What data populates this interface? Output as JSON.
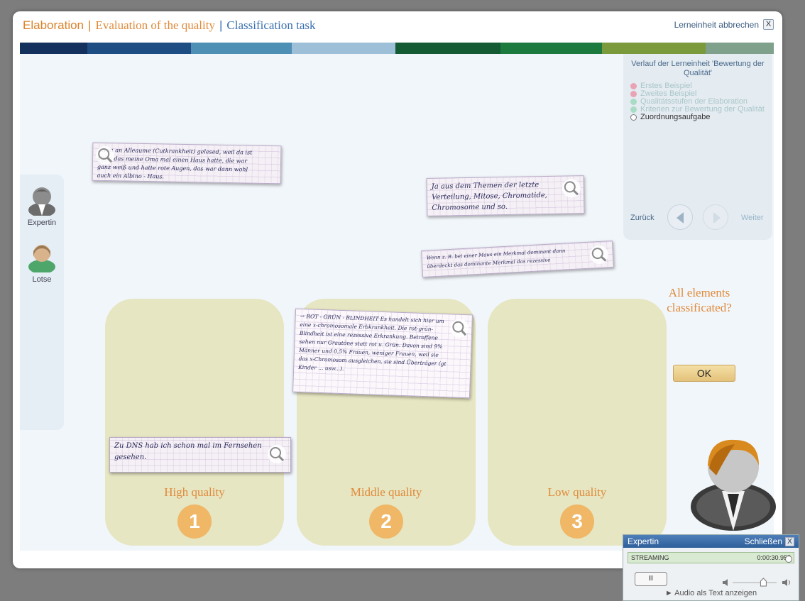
{
  "header": {
    "crumb_1": "Elaboration",
    "sep_1": "|",
    "crumb_2": "Evaluation of the quality",
    "sep_2": "|",
    "crumb_3": "Classification task",
    "abort_label": "Lerneinheit abbrechen",
    "abort_x": "X"
  },
  "colors": {
    "bar": [
      "#13315c",
      "#1e4d84",
      "#4e8fb6",
      "#9dbfd8",
      "#145a32",
      "#1d7a3e",
      "#7a9a3c",
      "#7fa08a"
    ],
    "accent": "#e08a3a",
    "drop_zone": "#e6e6c2"
  },
  "sidebar": {
    "items": [
      {
        "label": "Expertin",
        "icon": "expert-avatar-icon"
      },
      {
        "label": "Lotse",
        "icon": "guide-avatar-icon"
      }
    ]
  },
  "progress": {
    "title": "Verlauf der Lerneinheit 'Bewertung der Qualität'",
    "items": [
      {
        "label": "Erstes Beispiel",
        "dot": "#e8a3b4",
        "state": "done"
      },
      {
        "label": "Zweites Beispiel",
        "dot": "#e8a3b4",
        "state": "done"
      },
      {
        "label": "Qualitätsstufen der Elaboration",
        "dot": "#a9dcc4",
        "state": "done"
      },
      {
        "label": "Kriterien zur Bewertung der Qualität",
        "dot": "#a9dcc4",
        "state": "done"
      },
      {
        "label": "Zuordnungsaufgabe",
        "dot": "#ffffff",
        "state": "active"
      }
    ],
    "back_label": "Zurück",
    "next_label": "Weiter"
  },
  "notes": [
    {
      "text": "…von an Alleaume (Cutkrankheit) gelesed, weil da ist alter, das meine Oma mal einen Haus hatte, die war ganz weiß und hatte rote Augen, das war dann wohl auch ein Albino - Haus."
    },
    {
      "text": "Ja aus dem Themen der letzte Verteilung, Mitose, Chromatide, Chromosome und so."
    },
    {
      "text": "Wenn z. B. bei einer Maus ein Merkmal dominant dann überdeckt das dominante Merkmal das rezessive"
    },
    {
      "text": "→ ROT - GRÜN - BLINDHEIT  Es handelt sich hier um eine x-chromosomale Erbkrankheit. Die rot-grün-Blindheit ist eine rezessive Erkrankung. Betroffene sehen nur Grautöne statt rot u. Grün. Davon sind 9% Männer und 0,5% Frauen, weniger Frauen, weil sie das x-Chromosom ausgleichen, sie sind Überträger (gt Kinder ... usw...)."
    },
    {
      "text": "Zu DNS hab ich schon mal im Fernsehen gesehen."
    }
  ],
  "zones": [
    {
      "label": "High quality",
      "num": "1"
    },
    {
      "label": "Middle quality",
      "num": "2"
    },
    {
      "label": "Low quality",
      "num": "3"
    }
  ],
  "question": "All elements classificated?",
  "ok_label": "OK",
  "player": {
    "title": "Expertin",
    "close_label": "Schließen",
    "close_x": "X",
    "status": "STREAMING",
    "time": "0:00:30.955",
    "pause_label": "II",
    "audio_text_label": "► Audio als Text anzeigen",
    "progress": 0.98,
    "volume": 0.7
  }
}
